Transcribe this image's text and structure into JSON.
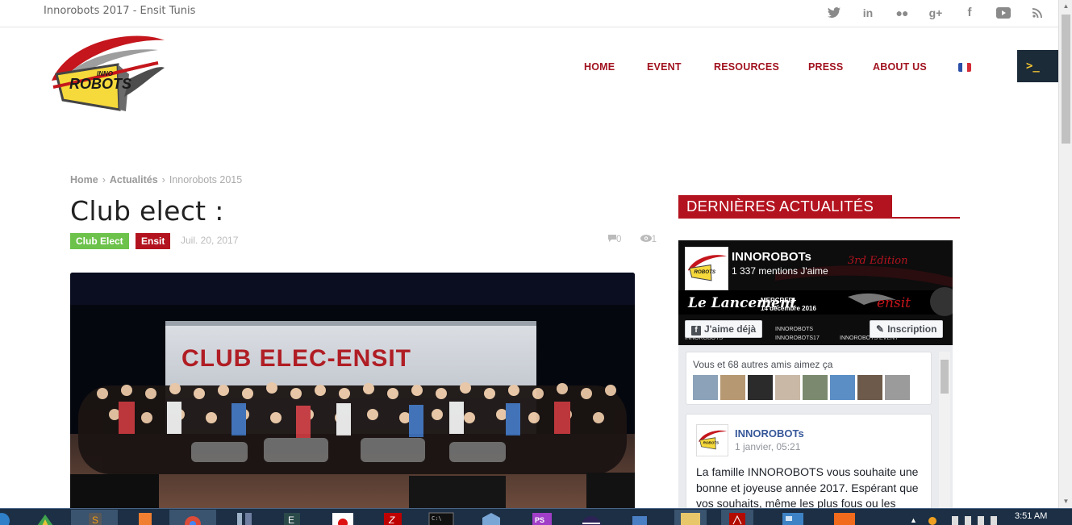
{
  "topbar": {
    "site_tag": "Innorobots 2017 - Ensit Tunis",
    "social_icons": [
      "twitter-icon",
      "linkedin-icon",
      "flickr-icon",
      "google-plus-icon",
      "facebook-icon",
      "youtube-icon",
      "rss-icon"
    ],
    "social_glyphs": [
      "🐦",
      "in",
      "••",
      "g+",
      "f",
      "▶",
      "◝"
    ]
  },
  "nav": {
    "items": [
      "HOME",
      "EVENT",
      "RESOURCES",
      "PRESS",
      "ABOUT US"
    ],
    "language": "french-flag"
  },
  "terminal_button": {
    "label": ">_"
  },
  "breadcrumb": {
    "home": "Home",
    "section": "Actualités",
    "current": "Innorobots 2015"
  },
  "post": {
    "title": "Club elect :",
    "tags": [
      "Club Elect",
      "Ensit"
    ],
    "date": "Juil. 20, 2017",
    "comments": "0",
    "views": "1",
    "image_banner": "CLUB ELEC-ENSIT"
  },
  "sidebar": {
    "title": "DERNIÈRES ACTUALITÉS",
    "facebook": {
      "page_name": "INNOROBOTs",
      "likes": "1 337 mentions J'aime",
      "edition": "3rd Edition",
      "launch": "Le Lancement",
      "launch_day": "MERCREDI",
      "launch_date": "14 décembre 2016",
      "ensit": "ensit",
      "like_button": "J'aime déjà",
      "signup_button": "Inscription",
      "cover_links": [
        "INNOROBOTS",
        "INNOROBOTS",
        "INNOROBOTS17",
        "INNOROBOTS EVENT"
      ],
      "friends_text": "Vous et 68 autres amis aimez ça",
      "post_author": "INNOROBOTs",
      "post_time": "1 janvier, 05:21",
      "post_text": "La famille INNOROBOTS vous souhaite une bonne et joyeuse année 2017. Espérant que vos souhaits, même les plus fous ou les"
    }
  },
  "taskbar": {
    "clock": "3:51 AM"
  },
  "colors": {
    "brand_red": "#b3131f",
    "tag_green": "#6cc24a",
    "terminal_bg": "#1c2b38",
    "taskbar_bg": "#1c2f45",
    "fb_blue": "#365899"
  }
}
